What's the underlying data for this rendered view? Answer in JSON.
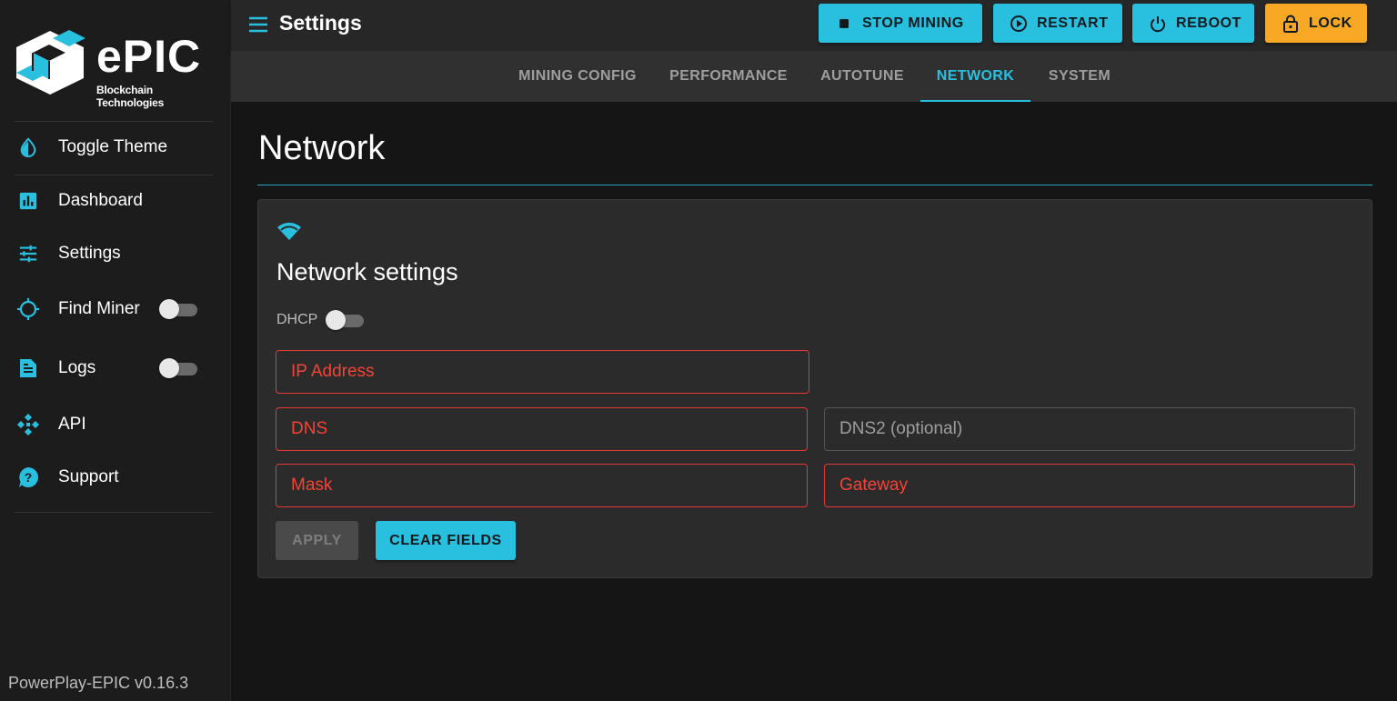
{
  "brand": {
    "name": "ePIC",
    "tagline": "Blockchain Technologies",
    "accent_color": "#29c0e0"
  },
  "sidebar": {
    "items": [
      {
        "label": "Toggle Theme",
        "icon": "theme-drop-icon"
      },
      {
        "label": "Dashboard",
        "icon": "bar-chart-icon"
      },
      {
        "label": "Settings",
        "icon": "tune-sliders-icon"
      },
      {
        "label": "Find Miner",
        "icon": "crosshair-icon",
        "toggle_on": false
      },
      {
        "label": "Logs",
        "icon": "document-icon",
        "toggle_on": false
      },
      {
        "label": "API",
        "icon": "api-diamond-icon"
      },
      {
        "label": "Support",
        "icon": "help-circle-icon"
      }
    ],
    "version": "PowerPlay-EPIC v0.16.3"
  },
  "topbar": {
    "title": "Settings",
    "buttons": {
      "stop_mining": "STOP MINING",
      "restart": "RESTART",
      "reboot": "REBOOT",
      "lock": "LOCK"
    },
    "lock_color": "#f9a825"
  },
  "tabs": [
    {
      "label": "MINING CONFIG",
      "active": false
    },
    {
      "label": "PERFORMANCE",
      "active": false
    },
    {
      "label": "AUTOTUNE",
      "active": false
    },
    {
      "label": "NETWORK",
      "active": true
    },
    {
      "label": "SYSTEM",
      "active": false
    }
  ],
  "main": {
    "title": "Network",
    "card": {
      "icon": "wifi-icon",
      "title": "Network settings",
      "dhcp_label": "DHCP",
      "dhcp_on": false,
      "fields": {
        "ip": {
          "placeholder": "IP Address",
          "value": "",
          "error": true
        },
        "dns": {
          "placeholder": "DNS",
          "value": "",
          "error": true
        },
        "dns2": {
          "placeholder": "DNS2 (optional)",
          "value": "",
          "error": false
        },
        "mask": {
          "placeholder": "Mask",
          "value": "",
          "error": true
        },
        "gateway": {
          "placeholder": "Gateway",
          "value": "",
          "error": true
        }
      },
      "apply_label": "APPLY",
      "clear_label": "CLEAR FIELDS",
      "error_color": "#f44336"
    }
  }
}
